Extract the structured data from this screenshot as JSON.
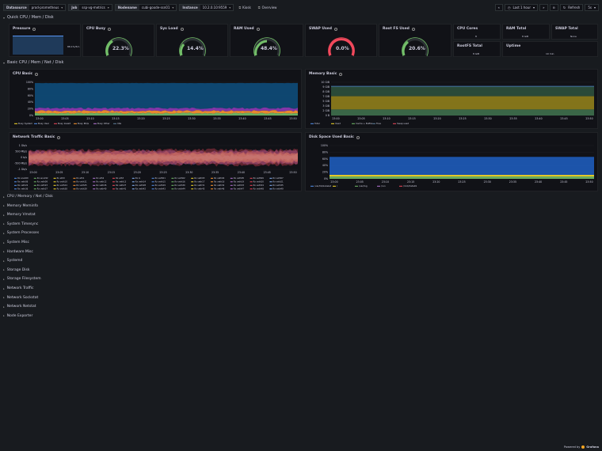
{
  "topbar": {
    "vars": [
      {
        "label": "Datasource",
        "value": "prod-prometheus"
      },
      {
        "label": "Job",
        "value": "ssp-vg-metrics"
      },
      {
        "label": "Nodename",
        "value": "cubi-goode-ssn01"
      },
      {
        "label": "Instance",
        "value": "10.2.0.10:9559"
      }
    ],
    "buttons": [
      {
        "label": "Kiosk",
        "icon": "link-icon"
      },
      {
        "label": "Overview",
        "icon": "link-icon"
      }
    ],
    "time_range": "Last 1 hour",
    "refresh_label": "Refresh",
    "refresh_interval": "5s"
  },
  "rows": {
    "quick": "Quick CPU / Mem / Disk",
    "basic": "Basic CPU / Mem / Net / Disk"
  },
  "quick_panels": {
    "pressure": "Pressure",
    "pressure_val": "88.1%/5m",
    "cpu_busy": "CPU Busy",
    "cpu_busy_val": "22.3%",
    "sys_load": "Sys Load",
    "sys_load_val": "14.4%",
    "ram_used": "RAM Used",
    "ram_used_val": "48.4%",
    "swap_used": "SWAP Used",
    "swap_used_val": "0.0%",
    "rootfs_used": "Root FS Used",
    "rootfs_used_val": "20.6%",
    "cpu_cores": "CPU Cores",
    "cpu_cores_val": "8",
    "ram_total": "RAM Total",
    "ram_total_val": "8 GiB",
    "swap_total": "SWAP Total",
    "swap_total_val": "None",
    "rootfs_total": "RootFS Total",
    "rootfs_total_val": "8 GiB",
    "uptime": "Uptime",
    "uptime_val": "10 min"
  },
  "basic_panels": {
    "cpu_basic": "CPU Basic",
    "memory_basic": "Memory Basic",
    "network": "Network Traffic Basic",
    "disk": "Disk Space Used Basic"
  },
  "time_ticks": [
    "23:00",
    "23:05",
    "23:10",
    "23:15",
    "23:20",
    "23:25",
    "23:30",
    "23:35",
    "23:40",
    "23:45",
    "23:50"
  ],
  "cpu_y": [
    "100%",
    "80%",
    "60%",
    "40%",
    "20%",
    "0%"
  ],
  "mem_y": [
    "10 GiB",
    "9 GiB",
    "8 GiB",
    "7 GiB",
    "5 GiB",
    "3 GiB",
    "2 GiB",
    "0 B"
  ],
  "net_y": [
    "1 Gb/s",
    "500 Mb/s",
    "0 b/s",
    "-500 Mb/s",
    "-1 Gb/s"
  ],
  "disk_y": [
    "100%",
    "80%",
    "60%",
    "40%",
    "20%",
    "0%"
  ],
  "cpu_legend": [
    "Busy System",
    "Busy User",
    "Busy Iowait",
    "Busy IRQs",
    "Busy Other",
    "Idle"
  ],
  "mem_legend": [
    "Total",
    "Used",
    "Cache + Buffer",
    "Free",
    "Swap used"
  ],
  "disk_legend": [
    "/var/lib/kubelet",
    "/",
    "/var/log",
    "/run",
    "/mnt/data01"
  ],
  "net_legend": [
    "Rx ens160",
    "Rx ens192",
    "Rx eth0",
    "Rx eth1",
    "Rx eth2",
    "Rx eth3",
    "Rx lo",
    "Rx veth01",
    "Rx veth02",
    "Rx veth03",
    "Rx veth04",
    "Rx veth05",
    "Rx veth06",
    "Rx veth07",
    "Rx veth08",
    "Rx veth09",
    "Rx veth10",
    "Rx veth11",
    "Rx veth12",
    "Rx veth13",
    "Rx veth14",
    "Rx veth15",
    "Rx veth16",
    "Rx veth17",
    "Rx veth18",
    "Rx veth19",
    "Rx veth20",
    "Rx veth21",
    "Rx veth22",
    "Rx veth23",
    "Rx veth24",
    "Rx veth25",
    "Rx veth26",
    "Rx veth27",
    "Rx veth28",
    "Rx veth29",
    "Rx veth30",
    "Rx veth31",
    "Rx veth32",
    "Rx veth33",
    "Rx veth34",
    "Rx veth35",
    "Rx veth36",
    "Rx veth37",
    "Rx veth38",
    "Rx veth39",
    "Rx veth40",
    "Rx veth41",
    "Rx veth42",
    "Rx veth43",
    "Rx veth44",
    "Rx veth45",
    "Rx veth46",
    "Rx veth47",
    "Rx veth48",
    "Rx veth49"
  ],
  "collapsed_rows": [
    "CPU / Memory / Net / Disk",
    "Memory Meminfo",
    "Memory Vmstat",
    "System Timesync",
    "System Processes",
    "System Misc",
    "Hardware Misc",
    "Systemd",
    "Storage Disk",
    "Storage Filesystem",
    "Network Traffic",
    "Network Sockstat",
    "Network Netstat",
    "Node Exporter"
  ],
  "footer": {
    "powered": "Powered by",
    "brand": "Grafana"
  },
  "colors": {
    "green": "#73bf69",
    "yellow": "#fade2a",
    "red": "#f2495c",
    "blue": "#5794f2",
    "orange": "#ff9830",
    "purple": "#b877d9",
    "bg": "#181b1f",
    "panel": "#111217"
  }
}
